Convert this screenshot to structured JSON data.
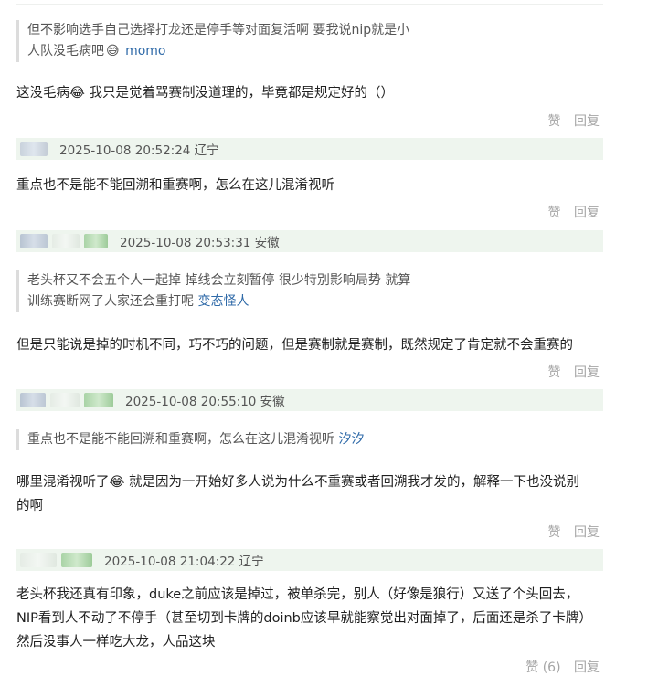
{
  "thread": [
    {
      "quote": {
        "text_lines": [
          "但不影响选手自己选择打龙还是停手等对面复活啊 要我说nip就是小",
          "人队没毛病吧"
        ],
        "author": "momo"
      },
      "comment": "这没毛病😂 我只是觉着骂赛制没道理的，毕竟都是规定好的（）",
      "actions": {
        "like": "赞",
        "reply": "回复"
      }
    }
  ],
  "posts": [
    {
      "meta": "2025-10-08 20:52:24 辽宁",
      "text": "重点也不是能不能回溯和重赛啊，怎么在这儿混淆视听",
      "like": "赞",
      "reply": "回复"
    },
    {
      "meta": "2025-10-08 20:53:31 安徽",
      "quote": {
        "text_lines": [
          "老头杯又不会五个人一起掉 掉线会立刻暂停 很少特别影响局势 就算",
          "训练赛断网了人家还会重打呢"
        ],
        "author": "变态怪人"
      },
      "text": "但是只能说是掉的时机不同，巧不巧的问题，但是赛制就是赛制，既然规定了肯定就不会重赛的",
      "like": "赞",
      "reply": "回复"
    },
    {
      "meta": "2025-10-08 20:55:10 安徽",
      "quote": {
        "text_lines": [
          "重点也不是能不能回溯和重赛啊，怎么在这儿混淆视听"
        ],
        "author": "汐汐"
      },
      "text_lines": [
        "哪里混淆视听了😂 就是因为一开始好多人说为什么不重赛或者回溯我才发的，解释一下也没说别",
        "的啊"
      ],
      "like": "赞",
      "reply": "回复"
    },
    {
      "meta": "2025-10-08 21:04:22 辽宁",
      "text_lines": [
        "老头杯我还真有印象，duke之前应该是掉过，被单杀完，别人（好像是狼行）又送了个头回去，",
        "NIP看到人不动了不停手（甚至切到卡牌的doinb应该早就能察觉出对面掉了，后面还是杀了卡牌）",
        "然后没事人一样吃大龙，人品这块"
      ],
      "like": "赞 (6)",
      "reply": "回复"
    }
  ],
  "emoji_icon": "grinning-sweat-emoji"
}
